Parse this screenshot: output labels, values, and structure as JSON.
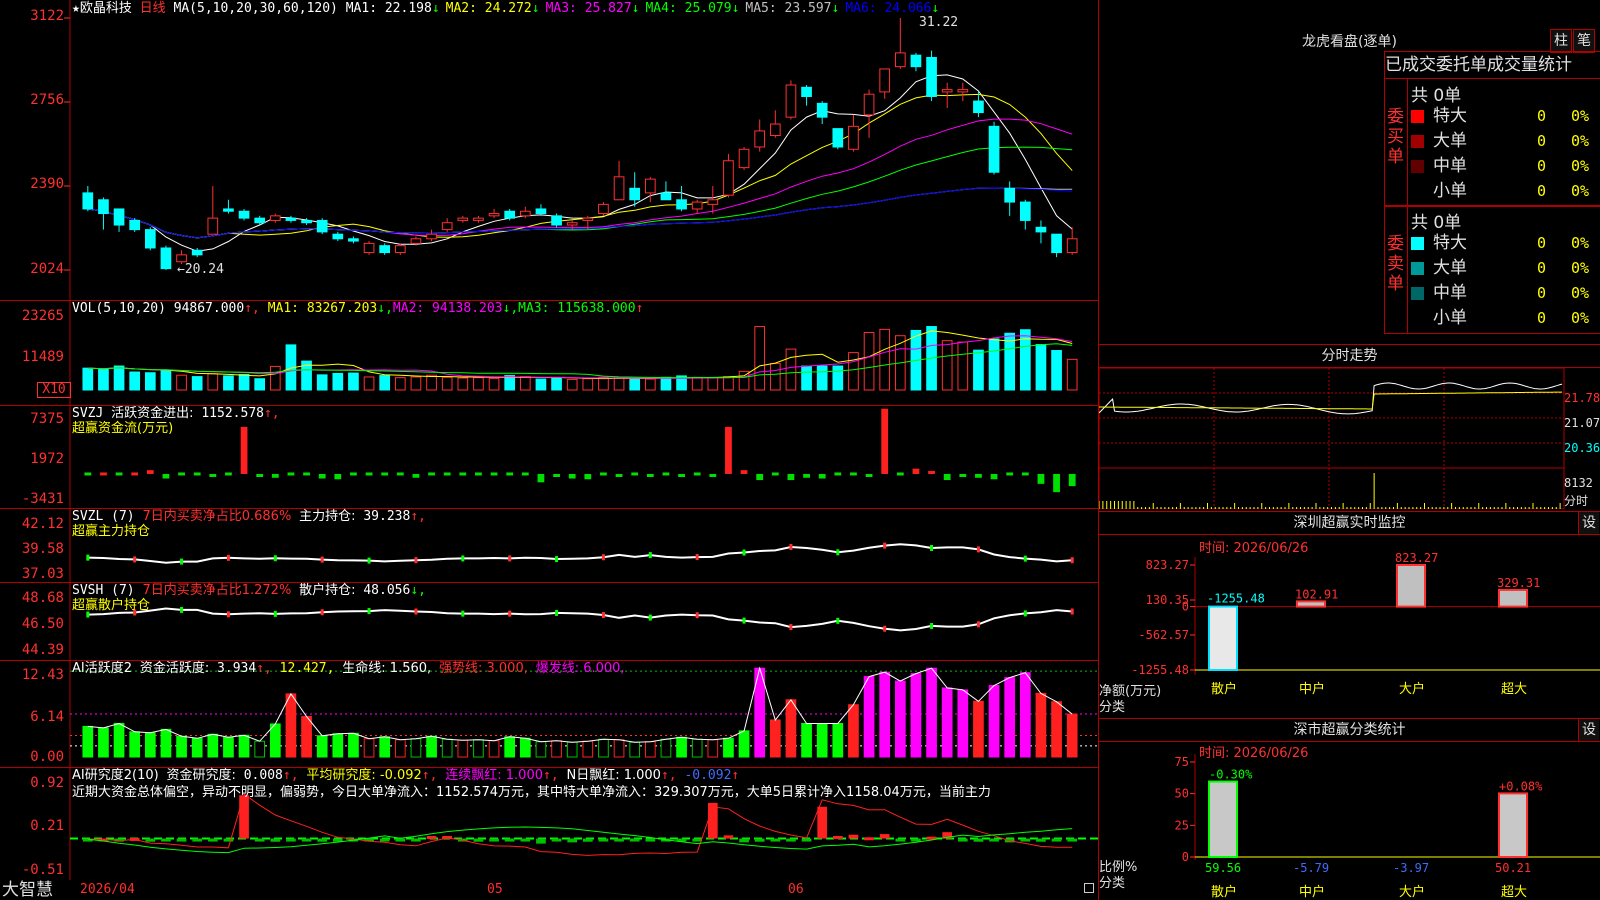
{
  "stock": {
    "name": "欧晶科技",
    "period": "日线",
    "star": "★"
  },
  "price_pane": {
    "ma_params": "MA(5,10,20,30,60,120)",
    "ma": [
      {
        "label": "MA1:",
        "value": "22.198",
        "arrow": "↓",
        "color": "#ffffff"
      },
      {
        "label": "MA2:",
        "value": "24.272",
        "arrow": "↓",
        "color": "#ffff00"
      },
      {
        "label": "MA3:",
        "value": "25.827",
        "arrow": "↓",
        "color": "#ff00ff"
      },
      {
        "label": "MA4:",
        "value": "25.079",
        "arrow": "↓",
        "color": "#00ff00"
      },
      {
        "label": "MA5:",
        "value": "23.597",
        "arrow": "↓",
        "color": "#c0c0c0"
      },
      {
        "label": "MA6:",
        "value": "24.066",
        "arrow": "↓",
        "color": "#0000ff"
      }
    ],
    "axis": [
      "3122",
      "2756",
      "2390",
      "2024"
    ],
    "high_mark": "31.22",
    "low_mark": "←20.24"
  },
  "vol_pane": {
    "title": "VOL(5,10,20)",
    "value": "94867.000",
    "arrow": "↑,",
    "ma": [
      {
        "label": "MA1:",
        "value": "83267.203",
        "arrow": "↓,",
        "color": "#ffff00"
      },
      {
        "label": "MA2:",
        "value": "94138.203",
        "arrow": "↓,",
        "color": "#ff00ff"
      },
      {
        "label": "MA3:",
        "value": "115638.000",
        "arrow": "↑",
        "color": "#00ff00"
      }
    ],
    "axis": [
      "23265",
      "11489"
    ],
    "unit": "X10"
  },
  "svzj_pane": {
    "name": "SVZJ",
    "label": "活跃资金进出:",
    "value": "1152.578",
    "arrow": "↑,",
    "subtitle": "超赢资金流(万元)",
    "axis": [
      "7375",
      "1972",
      "-3431"
    ]
  },
  "svzl_pane": {
    "name": "SVZL (7)",
    "label1": "7日内买卖净占比0.686%",
    "label2": "主力持仓:",
    "value": "39.238",
    "arrow": "↑,",
    "subtitle": "超赢主力持仓",
    "axis": [
      "42.12",
      "39.58",
      "37.03"
    ]
  },
  "svsh_pane": {
    "name": "SVSH (7)",
    "label1": "7日内买卖净占比1.272%",
    "label2": "散户持仓:",
    "value": "48.056",
    "arrow": "↓,",
    "subtitle": "超赢散户持仓",
    "axis": [
      "48.68",
      "46.50",
      "44.39"
    ]
  },
  "ai1_pane": {
    "name": "AI活跃度2",
    "label": "资金活跃度:",
    "value": "3.934",
    "arrow": "↑,",
    "v2": "12.427,",
    "life": "生命线: 1.560,",
    "strong": "强势线: 3.000,",
    "burst": "爆发线: 6.000,",
    "axis": [
      "12.43",
      "6.14",
      "0.00"
    ]
  },
  "ai2_pane": {
    "name": "AI研究度2(10)",
    "label": "资金研究度:",
    "value": "0.008",
    "arrow": "↑,",
    "avg": "平均研究度: -0.092",
    "avg_arrow": "↑,",
    "cont": "连续飘红: 1.000",
    "cont_arrow": "↑,",
    "nred": "N日飘红: 1.000",
    "nred_arrow": "↑,",
    "last": "-0.092",
    "last_arrow": "↑",
    "text": "近期大资金总体偏空，异动不明显，偏弱势，今日大单净流入：1152.574万元，其中特大单净流入：329.307万元，大单5日累计净入1158.04万元，当前主力",
    "axis": [
      "0.92",
      "0.21",
      "-0.51"
    ]
  },
  "date_axis": {
    "app": "大智慧",
    "d1": "2026/04",
    "d2": "05",
    "d3": "06"
  },
  "longhu": {
    "title": "龙虎看盘(逐单)",
    "btn1": "柱",
    "btn2": "笔",
    "tab1": "已成交委托单成交量统计",
    "buy_label": "委买单",
    "sell_label": "委卖单",
    "buy_total": "共 0单",
    "sell_total": "共 0单",
    "buy_rows": [
      {
        "name": "特大",
        "count": "0",
        "pct": "0%",
        "color": "#ff0000"
      },
      {
        "name": "大单",
        "count": "0",
        "pct": "0%",
        "color": "#a00000"
      },
      {
        "name": "中单",
        "count": "0",
        "pct": "0%",
        "color": "#600000"
      },
      {
        "name": "小单",
        "count": "0",
        "pct": "0%",
        "color": "#000000"
      }
    ],
    "sell_rows": [
      {
        "name": "特大",
        "count": "0",
        "pct": "0%",
        "color": "#00ffff"
      },
      {
        "name": "大单",
        "count": "0",
        "pct": "0%",
        "color": "#009999"
      },
      {
        "name": "中单",
        "count": "0",
        "pct": "0%",
        "color": "#006666"
      },
      {
        "name": "小单",
        "count": "0",
        "pct": "0%",
        "color": "#000000"
      }
    ]
  },
  "intraday": {
    "title": "分时走势",
    "prices": [
      "21.78",
      "21.07",
      "20.36"
    ],
    "vol": "8132",
    "unit": "分时"
  },
  "sz_monitor": {
    "title": "深圳超赢实时监控",
    "btn": "设",
    "time": "时间: 2026/06/26",
    "axis": [
      "823.27",
      "130.35",
      "0",
      "-562.57",
      "-1255.48"
    ],
    "ylabel": "净额(万元)",
    "xlabel": "分类",
    "categories": [
      "散户",
      "中户",
      "大户",
      "超大"
    ],
    "values": [
      -1255.48,
      102.91,
      823.27,
      329.31
    ],
    "value_labels": [
      "-1255.48",
      "102.91",
      "823.27",
      "329.31"
    ]
  },
  "sz_classify": {
    "title": "深市超赢分类统计",
    "btn": "设",
    "time": "时间: 2026/06/26",
    "axis": [
      "75",
      "50",
      "25",
      "0"
    ],
    "ylabel": "比例%",
    "xlabel": "分类",
    "categories": [
      "散户",
      "中户",
      "大户",
      "超大"
    ],
    "values": [
      59.56,
      -5.79,
      -3.97,
      50.21
    ],
    "value_labels": [
      "59.56",
      "-5.79",
      "-3.97",
      "50.21"
    ],
    "change_labels": [
      "-0.30%",
      "",
      "",
      "+0.08%"
    ]
  },
  "chart_data": [
    {
      "type": "candlestick",
      "title": "欧晶科技 日线",
      "x": [
        "2026/04",
        "05",
        "06"
      ],
      "ylim": [
        20.24,
        31.22
      ],
      "candles": [
        [
          23.6,
          22.9,
          23.9,
          22.8
        ],
        [
          23.3,
          22.7,
          23.4,
          22.0
        ],
        [
          22.9,
          22.2,
          22.9,
          21.9
        ],
        [
          22.4,
          22.0,
          22.5,
          21.9
        ],
        [
          22.0,
          21.2,
          22.1,
          21.1
        ],
        [
          21.2,
          20.3,
          21.3,
          20.24
        ],
        [
          20.6,
          20.9,
          21.1,
          20.5
        ],
        [
          21.1,
          20.9,
          21.2,
          20.8
        ],
        [
          21.8,
          22.5,
          23.9,
          21.8
        ],
        [
          22.9,
          22.8,
          23.3,
          22.7
        ],
        [
          22.8,
          22.5,
          22.9,
          22.4
        ],
        [
          22.5,
          22.3,
          22.6,
          22.2
        ],
        [
          22.4,
          22.6,
          22.7,
          22.3
        ],
        [
          22.5,
          22.4,
          22.6,
          22.3
        ],
        [
          22.4,
          22.3,
          22.5,
          22.2
        ],
        [
          22.4,
          21.9,
          22.5,
          21.8
        ],
        [
          21.8,
          21.6,
          21.9,
          21.5
        ],
        [
          21.6,
          21.5,
          21.7,
          21.4
        ],
        [
          21.0,
          21.4,
          21.5,
          20.9
        ],
        [
          21.3,
          21.0,
          21.4,
          20.9
        ],
        [
          21.0,
          21.3,
          21.4,
          20.9
        ],
        [
          21.4,
          21.6,
          21.7,
          21.3
        ],
        [
          21.6,
          21.8,
          22.0,
          21.5
        ],
        [
          22.0,
          22.3,
          22.5,
          21.9
        ],
        [
          22.4,
          22.5,
          22.6,
          22.3
        ],
        [
          22.4,
          22.5,
          22.6,
          22.3
        ],
        [
          22.6,
          22.7,
          22.9,
          22.5
        ],
        [
          22.8,
          22.5,
          22.9,
          22.4
        ],
        [
          22.6,
          22.8,
          23.0,
          22.5
        ],
        [
          22.9,
          22.7,
          23.1,
          22.6
        ],
        [
          22.6,
          22.2,
          22.7,
          22.1
        ],
        [
          22.2,
          22.3,
          22.4,
          22.0
        ],
        [
          22.4,
          22.5,
          22.6,
          22.0
        ],
        [
          22.7,
          23.1,
          23.2,
          22.6
        ],
        [
          23.3,
          24.3,
          25.0,
          23.3
        ],
        [
          23.8,
          23.3,
          24.5,
          23.0
        ],
        [
          23.6,
          24.2,
          24.3,
          23.2
        ],
        [
          23.6,
          23.3,
          24.1,
          23.3
        ],
        [
          23.3,
          22.9,
          23.9,
          22.8
        ],
        [
          22.9,
          23.2,
          23.3,
          22.7
        ],
        [
          23.1,
          23.3,
          23.9,
          22.7
        ],
        [
          23.5,
          25.0,
          25.3,
          23.4
        ],
        [
          24.7,
          25.5,
          25.6,
          24.6
        ],
        [
          25.6,
          26.3,
          26.8,
          25.4
        ],
        [
          26.1,
          26.6,
          27.2,
          26.0
        ],
        [
          26.9,
          28.3,
          28.5,
          26.8
        ],
        [
          28.2,
          27.8,
          28.3,
          27.4
        ],
        [
          27.5,
          26.9,
          27.6,
          26.6
        ],
        [
          26.4,
          25.6,
          26.4,
          25.5
        ],
        [
          25.5,
          26.5,
          27.0,
          25.4
        ],
        [
          27.0,
          27.9,
          28.1,
          26.0
        ],
        [
          28.0,
          29.0,
          29.0,
          27.7
        ],
        [
          29.1,
          29.7,
          31.22,
          29.0
        ],
        [
          29.6,
          29.1,
          29.7,
          28.9
        ],
        [
          29.5,
          27.8,
          29.8,
          27.6
        ],
        [
          28.0,
          28.1,
          28.4,
          27.3
        ],
        [
          28.0,
          28.1,
          28.4,
          27.6
        ],
        [
          27.6,
          27.1,
          28.0,
          26.9
        ],
        [
          26.5,
          24.5,
          26.7,
          24.4
        ],
        [
          23.8,
          23.2,
          24.1,
          22.6
        ],
        [
          23.2,
          22.4,
          23.3,
          22.0
        ],
        [
          22.1,
          21.9,
          22.4,
          21.4
        ],
        [
          21.8,
          21.0,
          21.8,
          20.8
        ],
        [
          21.0,
          21.6,
          22.1,
          20.9
        ]
      ]
    },
    {
      "type": "bar",
      "title": "VOL(5,10,20)",
      "ylim": [
        0,
        23265
      ],
      "values": [
        6200,
        5900,
        6800,
        5100,
        4900,
        5600,
        4200,
        3800,
        4600,
        4000,
        4400,
        3200,
        6700,
        12800,
        8200,
        4300,
        4700,
        4800,
        3700,
        4100,
        3500,
        3700,
        4200,
        3600,
        3400,
        3500,
        3300,
        4100,
        3800,
        3100,
        3300,
        3000,
        3200,
        3600,
        3500,
        3000,
        3100,
        3600,
        4000,
        3600,
        3500,
        3800,
        5300,
        18000,
        7500,
        11600,
        6800,
        6800,
        6800,
        10600,
        16300,
        17200,
        15400,
        16900,
        18000,
        14000,
        13600,
        11300,
        14500,
        16100,
        17100,
        12900,
        11200,
        8700
      ]
    },
    {
      "type": "bar",
      "title": "SVZJ 超赢资金流(万元)",
      "ylim": [
        -3431,
        7375
      ],
      "values": [
        -150,
        0,
        -200,
        0,
        500,
        -600,
        -200,
        -300,
        -400,
        -250,
        6200,
        -400,
        -500,
        -300,
        -200,
        -600,
        -700,
        -300,
        -250,
        -200,
        -300,
        -500,
        -200,
        -300,
        -250,
        -200,
        -300,
        -300,
        -250,
        -1100,
        -400,
        -600,
        -700,
        -300,
        -400,
        -300,
        -400,
        -300,
        -400,
        -300,
        -400,
        6200,
        500,
        -800,
        -300,
        -800,
        -500,
        -600,
        -200,
        -300,
        -400,
        8600,
        -300,
        700,
        400,
        -800,
        -400,
        -500,
        -700,
        -200,
        -300,
        -1300,
        -2400,
        -1600,
        -400
      ]
    },
    {
      "type": "line",
      "title": "AI研究度2(10)",
      "ylim": [
        -0.51,
        0.92
      ],
      "values": [
        -0.01,
        0.0,
        -0.02,
        0.01,
        -0.05,
        -0.02,
        -0.03,
        -0.04,
        -0.02,
        -0.03,
        0.68,
        -0.04,
        -0.05,
        -0.02,
        -0.03,
        -0.05,
        -0.05,
        -0.02,
        -0.03,
        -0.02,
        -0.04,
        -0.03,
        0.04,
        0.04,
        -0.03,
        -0.05,
        -0.04,
        -0.02,
        -0.03,
        -0.08,
        -0.04,
        -0.06,
        -0.05,
        -0.03,
        -0.04,
        -0.02,
        -0.03,
        -0.04,
        -0.02,
        -0.03,
        0.56,
        0.05,
        -0.06,
        -0.05,
        -0.04,
        -0.03,
        -0.03,
        0.5,
        0.04,
        0.06,
        0.02,
        0.07,
        -0.03,
        -0.04,
        0.03,
        0.1,
        -0.03,
        -0.05,
        -0.04,
        -0.06,
        -0.04,
        -0.05,
        -0.03,
        -0.02,
        0.008
      ]
    }
  ]
}
